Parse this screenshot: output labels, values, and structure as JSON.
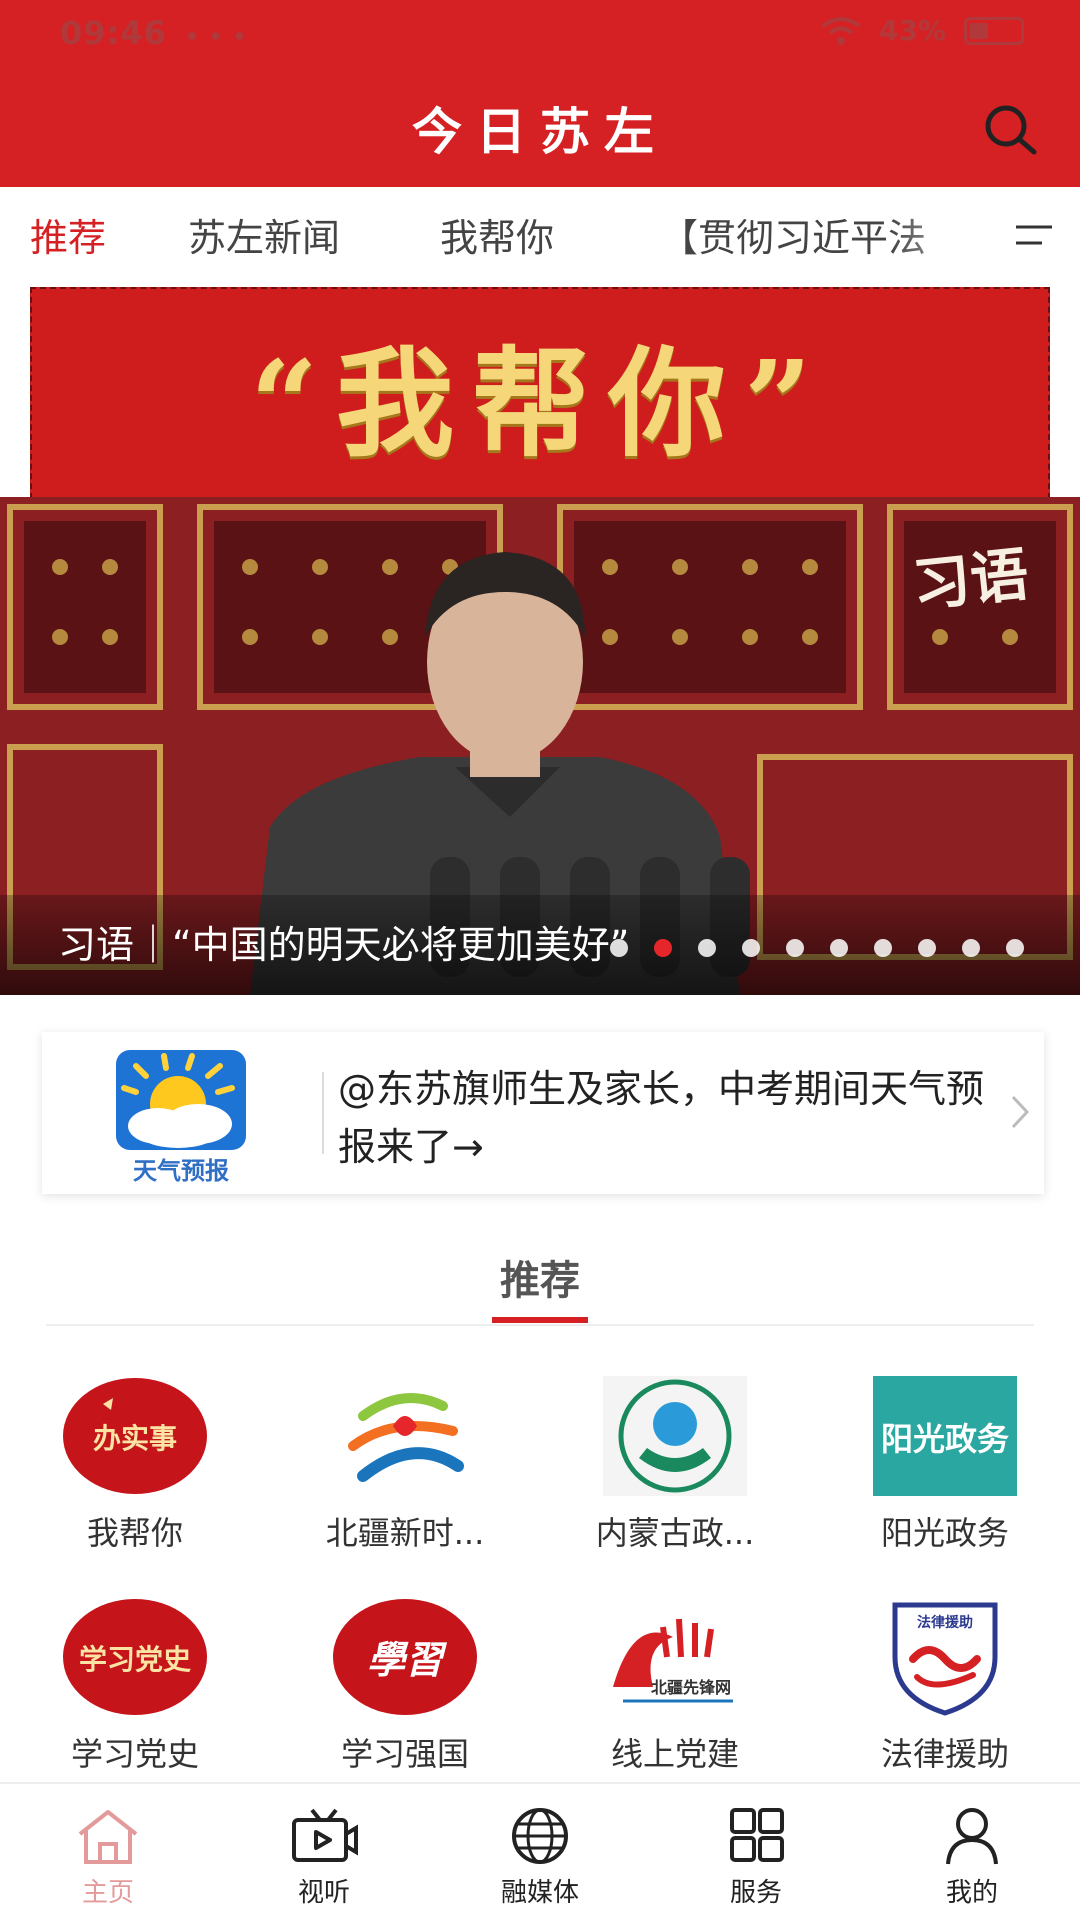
{
  "status_bar": {
    "time": "09:46",
    "dots": "• • •",
    "battery": "43%"
  },
  "header": {
    "title": "今日苏左"
  },
  "tabs": [
    {
      "label": "推荐",
      "active": true
    },
    {
      "label": "苏左新闻",
      "active": false
    },
    {
      "label": "我帮你",
      "active": false
    },
    {
      "label": "【贯彻习近平法",
      "active": false
    }
  ],
  "banner": {
    "text": "“我帮你”"
  },
  "hero": {
    "brand": "习语",
    "caption": "习语｜“中国的明天必将更加美好”",
    "slide_count": 10,
    "active_slide": 1
  },
  "notice": {
    "logo_label": "天气预报",
    "text": "@东苏旗师生及家长，中考期间天气预报来了→"
  },
  "recommended": {
    "title": "推荐",
    "items": [
      {
        "label": "我帮你",
        "icon": "serve-the-people-icon",
        "icon_text": "办实事"
      },
      {
        "label": "北疆新时...",
        "icon": "beijiang-logo-icon",
        "icon_text": ""
      },
      {
        "label": "内蒙古政...",
        "icon": "inner-mongolia-gov-icon",
        "icon_text": ""
      },
      {
        "label": "阳光政务",
        "icon": "sunshine-gov-icon",
        "icon_text": "阳光政务"
      },
      {
        "label": "学习党史",
        "icon": "party-history-icon",
        "icon_text": "学习党史"
      },
      {
        "label": "学习强国",
        "icon": "xuexi-qiangguo-icon",
        "icon_text": "學習"
      },
      {
        "label": "线上党建",
        "icon": "online-party-building-icon",
        "icon_text": "北疆先锋网"
      },
      {
        "label": "法律援助",
        "icon": "legal-aid-icon",
        "icon_text": "法律援助"
      }
    ]
  },
  "bottom_nav": [
    {
      "label": "主页",
      "icon": "home-icon",
      "active": true
    },
    {
      "label": "视听",
      "icon": "tv-icon",
      "active": false
    },
    {
      "label": "融媒体",
      "icon": "globe-icon",
      "active": false
    },
    {
      "label": "服务",
      "icon": "grid-icon",
      "active": false
    },
    {
      "label": "我的",
      "icon": "user-icon",
      "active": false
    }
  ],
  "colors": {
    "brand_red": "#d52124",
    "accent_gold": "#f5d77a",
    "inactive_nav_home": "#e39a9b"
  }
}
